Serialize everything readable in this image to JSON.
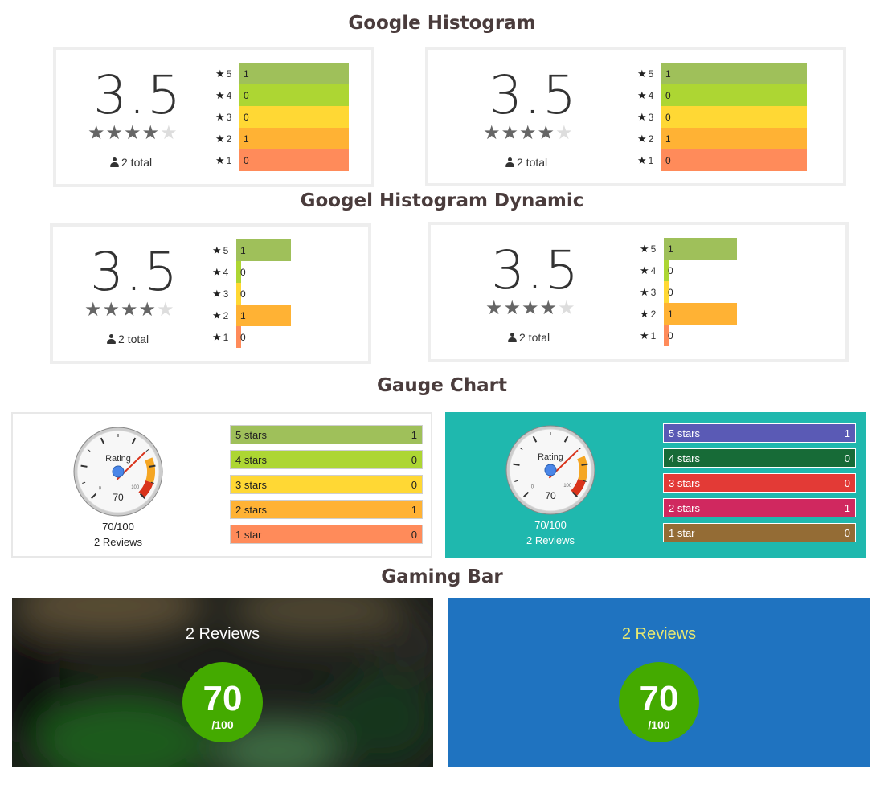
{
  "sections": {
    "google_histogram": "Google Histogram",
    "googel_histogram_dynamic": "Googel Histogram Dynamic",
    "gauge_chart": "Gauge Chart",
    "gaming_bar": "Gaming Bar"
  },
  "rating": {
    "score": "3.5",
    "stars_filled": 4,
    "stars_total": 5,
    "total": "2 total"
  },
  "histogram": {
    "rows": [
      {
        "star": "5",
        "count": "1",
        "value": 1,
        "color": "#9fc05a"
      },
      {
        "star": "4",
        "count": "0",
        "value": 0,
        "color": "#add633"
      },
      {
        "star": "3",
        "count": "0",
        "value": 0,
        "color": "#ffd834"
      },
      {
        "star": "2",
        "count": "1",
        "value": 1,
        "color": "#ffb234"
      },
      {
        "star": "1",
        "count": "0",
        "value": 0,
        "color": "#ff8b5a"
      }
    ],
    "max": 1
  },
  "gauge": {
    "label": "Rating",
    "value": 70,
    "value_text": "70",
    "min_text": "0",
    "max_text": "100",
    "score_text": "70/100",
    "reviews": "2 Reviews",
    "bars": [
      {
        "label": "5 stars",
        "count": "1"
      },
      {
        "label": "4 stars",
        "count": "0"
      },
      {
        "label": "3 stars",
        "count": "0"
      },
      {
        "label": "2 stars",
        "count": "1"
      },
      {
        "label": "1 star",
        "count": "0"
      }
    ],
    "light_colors": [
      "#9fc05a",
      "#add633",
      "#ffd834",
      "#ffb234",
      "#ff8b5a"
    ],
    "teal_colors": [
      "#5a5ab5",
      "#176b37",
      "#e33a36",
      "#d0285f",
      "#946c35"
    ],
    "teal_bg": "#1fb8ae"
  },
  "gaming": {
    "reviews": "2 Reviews",
    "score": "70",
    "out_of": "/100",
    "blue_bg": "#1f73c0",
    "circle_color": "#44aa00",
    "blue_title_color": "#e8e870"
  }
}
